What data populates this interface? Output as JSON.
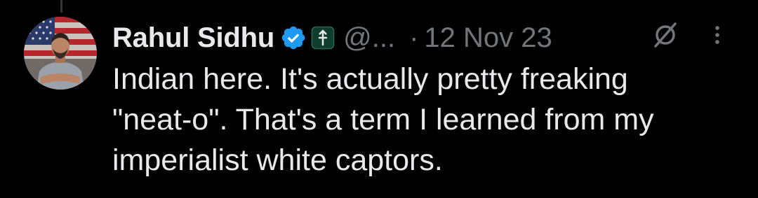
{
  "tweet": {
    "author_name": "Rahul Sidhu",
    "handle": "@...",
    "separator": "·",
    "date": "12 Nov 23",
    "text_lines": [
      "Indian here. It's actually pretty freaking",
      "\"neat-o\". That's a term I learned from my",
      "imperialist white captors."
    ]
  },
  "icons": {
    "verified": "verified-badge-icon",
    "affiliation": "affiliation-badge-icon",
    "grok": "grok-icon",
    "more": "more-options-icon"
  },
  "colors": {
    "background": "#000000",
    "text_primary": "#e7e9ea",
    "text_secondary": "#71767b",
    "verified_blue": "#1d9bf0"
  }
}
